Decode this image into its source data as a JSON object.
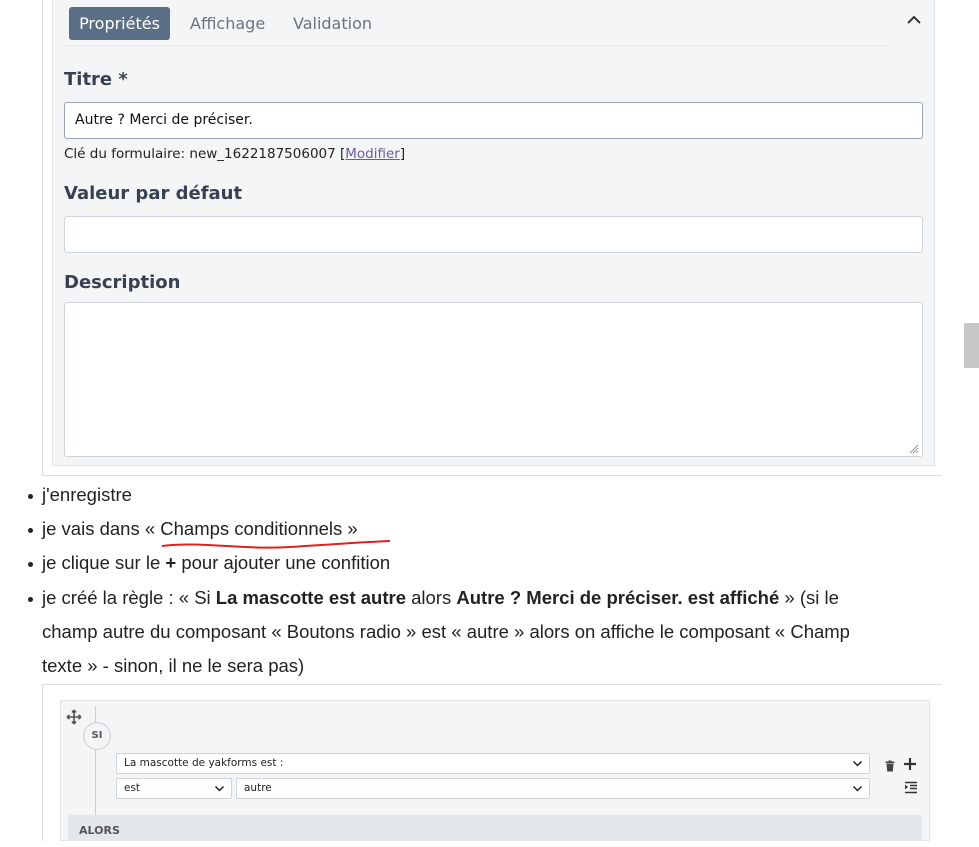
{
  "form": {
    "tabs": [
      {
        "label": "Propriétés",
        "active": true
      },
      {
        "label": "Affichage",
        "active": false
      },
      {
        "label": "Validation",
        "active": false
      }
    ],
    "collapse_icon": "chevron-up-icon",
    "title_label": "Titre *",
    "title_value": "Autre ? Merci de préciser.",
    "form_key_prefix": "Clé du formulaire: new_1622187506007 [",
    "form_key_link": "Modifier",
    "form_key_suffix": "]",
    "default_label": "Valeur par défaut",
    "default_value": "",
    "description_label": "Description",
    "description_value": ""
  },
  "steps": {
    "s1": "j'enregistre",
    "s2_prefix": "je vais dans ",
    "s2_highlight": "« Champs conditionnels »",
    "s3_a": "je clique sur le ",
    "s3_b": "+",
    "s3_c": " pour ajouter une confition",
    "s4_a": "je créé la règle : « Si ",
    "s4_b": "La mascotte est autre",
    "s4_c": " alors ",
    "s4_d": "Autre ? Merci de préciser. est affiché",
    "s4_e": " » (si le",
    "s4_line2": "champ autre du composant « Boutons radio » est « autre » alors on affiche le composant « Champ",
    "s4_line3": "texte » - sinon, il ne le sera pas)"
  },
  "builder": {
    "si_label": "SI",
    "field_select": "La mascotte de yakforms est :",
    "operator_select": "est",
    "value_select": "autre",
    "alors_label": "ALORS",
    "icons": [
      "move-icon",
      "trash-icon",
      "plus-icon",
      "indent-icon"
    ]
  },
  "colors": {
    "active_tab_bg": "#5a6f86",
    "link": "#6d5a9c",
    "annotation_underline": "#e02020"
  }
}
